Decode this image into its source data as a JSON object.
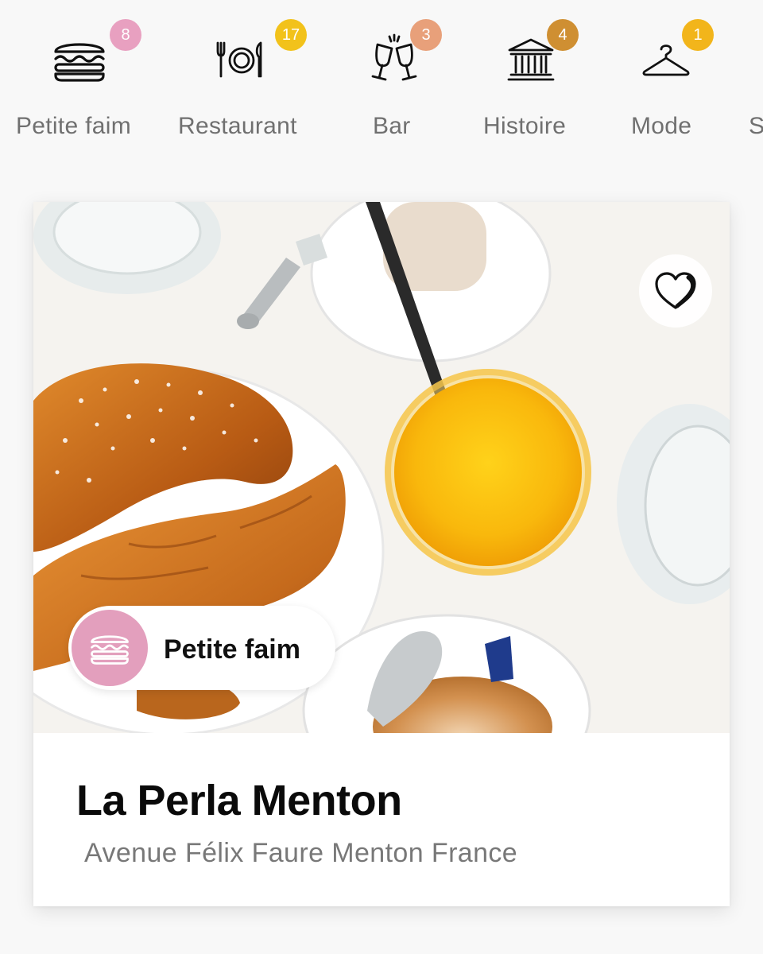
{
  "categories": [
    {
      "label": "Petite faim",
      "count": "8",
      "icon": "burger-icon",
      "badge_color": "#e8a0c0"
    },
    {
      "label": "Restaurant",
      "count": "17",
      "icon": "plate-cutlery-icon",
      "badge_color": "#f2c21b"
    },
    {
      "label": "Bar",
      "count": "3",
      "icon": "cheers-glasses-icon",
      "badge_color": "#e8a07a"
    },
    {
      "label": "Histoire",
      "count": "4",
      "icon": "museum-icon",
      "badge_color": "#cf8f32"
    },
    {
      "label": "Mode",
      "count": "1",
      "icon": "hanger-icon",
      "badge_color": "#f2b51b"
    },
    {
      "label": "S",
      "count": "",
      "icon": "",
      "badge_color": ""
    }
  ],
  "card": {
    "category_chip": {
      "label": "Petite faim",
      "icon": "burger-icon",
      "color": "#e39fbd"
    },
    "favorite_icon": "heart-icon",
    "name": "La Perla Menton",
    "address": "Avenue Félix Faure Menton France"
  }
}
